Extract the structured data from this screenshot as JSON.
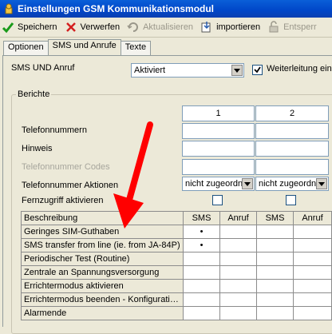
{
  "window": {
    "title": "Einstellungen GSM Kommunikationsmodul"
  },
  "toolbar": {
    "save": "Speichern",
    "discard": "Verwerfen",
    "refresh": "Aktualisieren",
    "import": "importieren",
    "unlock": "Entsperr"
  },
  "tabs": [
    "Optionen",
    "SMS und Anrufe",
    "Texte"
  ],
  "sms_call": {
    "label": "SMS UND Anruf",
    "value": "Aktiviert",
    "forward_label": "Weiterleitung ein",
    "forward_checked": true
  },
  "reports": {
    "group_title": "Berichte",
    "columns": [
      "1",
      "2"
    ],
    "phone_numbers_label": "Telefonnummern",
    "hint_label": "Hinweis",
    "codes_label": "Telefonnummer Codes",
    "actions_label": "Telefonnummer Aktionen",
    "actions_values": [
      "nicht zugeordn",
      "nicht zugeordn"
    ],
    "remote_label": "Fernzugriff aktivieren"
  },
  "grid": {
    "header": [
      "Beschreibung",
      "SMS",
      "Anruf",
      "SMS",
      "Anruf"
    ],
    "rows": [
      {
        "desc": "Geringes SIM-Guthaben",
        "marks": [
          "•",
          "",
          "",
          ""
        ]
      },
      {
        "desc": "SMS transfer from line (ie. from JA-84P)",
        "marks": [
          "•",
          "",
          "",
          ""
        ]
      },
      {
        "desc": "Periodischer Test (Routine)",
        "marks": [
          "",
          "",
          "",
          ""
        ]
      },
      {
        "desc": "Zentrale an Spannungsversorgung",
        "marks": [
          "",
          "",
          "",
          ""
        ]
      },
      {
        "desc": "Errichtermodus aktivieren",
        "marks": [
          "",
          "",
          "",
          ""
        ]
      },
      {
        "desc": "Errichtermodus beenden - Konfigurati…",
        "marks": [
          "",
          "",
          "",
          ""
        ]
      },
      {
        "desc": "Alarmende",
        "marks": [
          "",
          "",
          "",
          ""
        ]
      }
    ]
  },
  "colors": {
    "accent_arrow": "#ff0000",
    "titlebar": "#0a5fd8"
  }
}
